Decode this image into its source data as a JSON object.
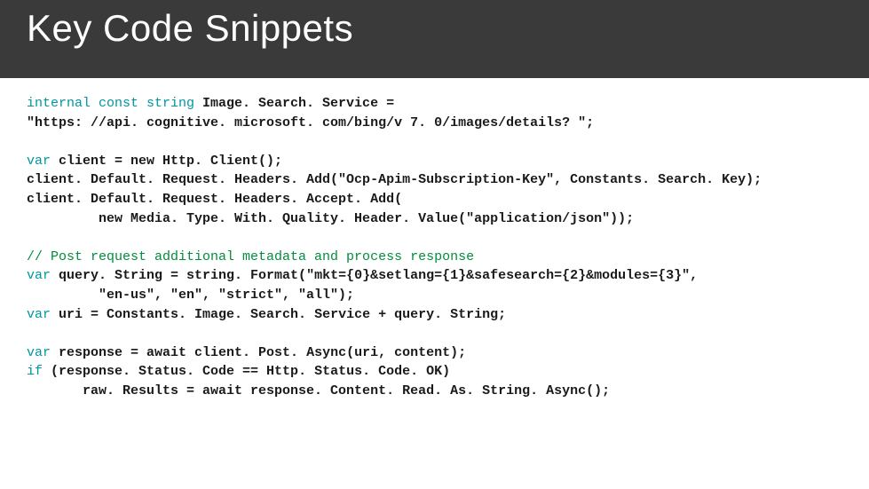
{
  "header": {
    "title": "Key Code Snippets"
  },
  "code": {
    "l1a": "internal const string",
    "l1b": " Image. Search. Service =",
    "l2": "\"https: //api. cognitive. microsoft. com/bing/v 7. 0/images/details? \";",
    "l3a": "var",
    "l3b": " client = new Http. Client();",
    "l4": "client. Default. Request. Headers. Add(\"Ocp-Apim-Subscription-Key\", Constants. Search. Key);",
    "l5": "client. Default. Request. Headers. Accept. Add(",
    "l6": "         new Media. Type. With. Quality. Header. Value(\"application/json\"));",
    "l7": "// Post request additional metadata and process response",
    "l8a": "var",
    "l8b": " query. String = string. Format(\"mkt={0}&setlang={1}&safesearch={2}&modules={3}\",",
    "l9": "         \"en-us\", \"en\", \"strict\", \"all\");",
    "l10a": "var",
    "l10b": " uri = Constants. Image. Search. Service + query. String;",
    "l11a": "var",
    "l11b": " response = await client. Post. Async(uri, content);",
    "l12a": "if",
    "l12b": " (response. Status. Code == Http. Status. Code. OK)",
    "l13": "       raw. Results = await response. Content. Read. As. String. Async();"
  }
}
